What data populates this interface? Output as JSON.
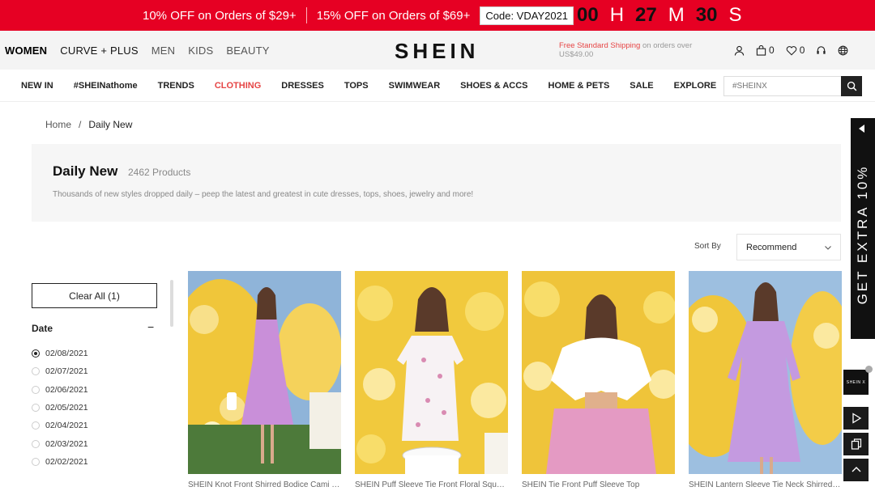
{
  "promo": {
    "offer1": "10% OFF on Orders of $29+",
    "offer2": "15% OFF on Orders of $69+",
    "code": "Code: VDAY2021",
    "countdown": {
      "hours": "00",
      "h": "H",
      "minutes": "27",
      "m": "M",
      "seconds": "30",
      "s": "S"
    }
  },
  "header": {
    "categories": [
      "WOMEN",
      "CURVE + PLUS",
      "MEN",
      "KIDS",
      "BEAUTY"
    ],
    "logo": "SHEIN",
    "shipping_highlight": "Free Standard Shipping",
    "shipping_rest": "on orders over US$49.00",
    "bag_count": "0",
    "wishlist_count": "0"
  },
  "nav": {
    "items": [
      "NEW IN",
      "#SHEINathome",
      "TRENDS",
      "CLOTHING",
      "DRESSES",
      "TOPS",
      "SWIMWEAR",
      "SHOES & ACCS",
      "HOME & PETS",
      "SALE",
      "EXPLORE"
    ],
    "search_placeholder": "#SHEINX"
  },
  "breadcrumb": {
    "home": "Home",
    "sep": "/",
    "current": "Daily New"
  },
  "banner": {
    "title": "Daily New",
    "count": "2462 Products",
    "description": "Thousands of new styles dropped daily – peep the latest and greatest in cute dresses, tops, shoes, jewelry and more!"
  },
  "sort": {
    "label": "Sort By",
    "value": "Recommend"
  },
  "filters": {
    "clear_all": "Clear All (1)",
    "date_title": "Date",
    "toggle": "−",
    "dates": [
      "02/08/2021",
      "02/07/2021",
      "02/06/2021",
      "02/05/2021",
      "02/04/2021",
      "02/03/2021",
      "02/02/2021"
    ]
  },
  "products": [
    {
      "name": "SHEIN Knot Front Shirred Bodice Cami Dress"
    },
    {
      "name": "SHEIN Puff Sleeve Tie Front Floral Square Neck Dress"
    },
    {
      "name": "SHEIN Tie Front Puff Sleeve Top"
    },
    {
      "name": "SHEIN Lantern Sleeve Tie Neck Shirred Dress"
    }
  ],
  "side": {
    "promo_tab": "GET EXTRA 10%",
    "badge": "SHEIN X"
  },
  "colors": {
    "promo_red": "#e60023",
    "accent_red": "#e64545"
  }
}
